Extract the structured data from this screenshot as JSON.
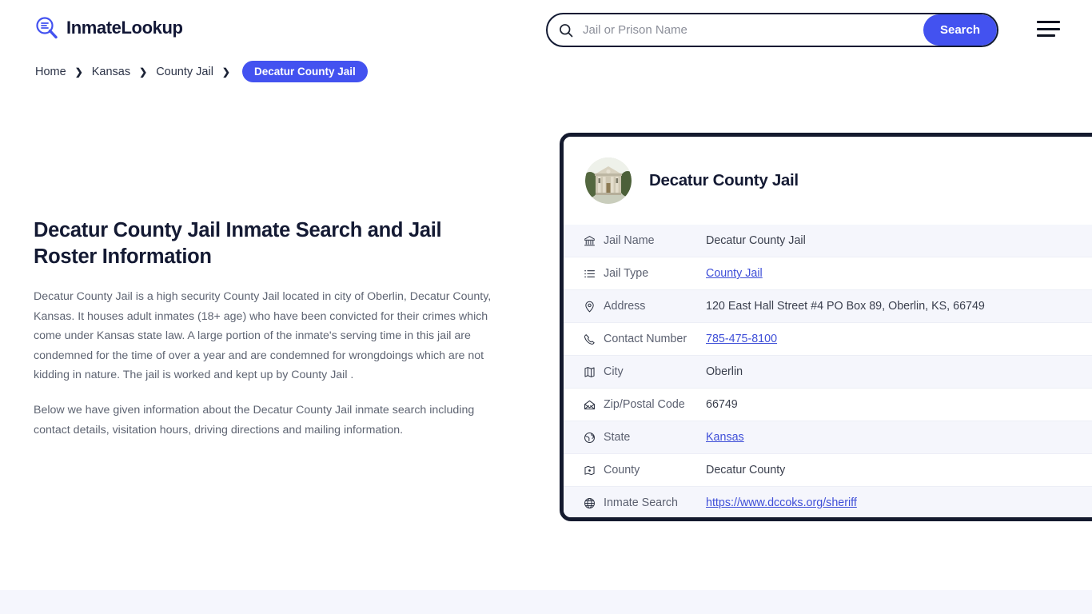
{
  "header": {
    "brand_name": "InmateLookup",
    "brand_icon": "search-list-logo-icon",
    "search": {
      "placeholder": "Jail or Prison Name",
      "value": "",
      "button_label": "Search",
      "icon": "search-icon"
    },
    "menu_icon": "hamburger-menu-icon"
  },
  "breadcrumb": {
    "items": [
      {
        "label": "Home",
        "current": false
      },
      {
        "label": "Kansas",
        "current": false
      },
      {
        "label": "County Jail",
        "current": false
      },
      {
        "label": "Decatur County Jail",
        "current": true
      }
    ],
    "separator": "❯"
  },
  "main": {
    "title": "Decatur County Jail Inmate Search and Jail Roster Information",
    "paragraphs": [
      "Decatur County Jail is a high security County Jail located in city of Oberlin, Decatur County, Kansas. It houses adult inmates (18+ age) who have been convicted for their crimes which come under Kansas state law. A large portion of the inmate's serving time in this jail are condemned for the time of over a year and are condemned for wrongdoings which are not kidding in nature. The jail is worked and kept up by County Jail .",
      "Below we have given information about the Decatur County Jail inmate search including contact details, visitation hours, driving directions and mailing information."
    ]
  },
  "info_card": {
    "photo_alt": "decatur-county-courthouse-photo",
    "title": "Decatur County Jail",
    "rows": [
      {
        "icon": "bank-building-icon",
        "label": "Jail Name",
        "value": "Decatur County Jail",
        "is_link": false
      },
      {
        "icon": "list-icon",
        "label": "Jail Type",
        "value": "County Jail",
        "is_link": true
      },
      {
        "icon": "map-pin-icon",
        "label": "Address",
        "value": "120 East Hall Street #4 PO Box 89, Oberlin, KS, 66749",
        "is_link": false
      },
      {
        "icon": "phone-icon",
        "label": "Contact Number",
        "value": "785-475-8100",
        "is_link": true
      },
      {
        "icon": "map-icon",
        "label": "City",
        "value": "Oberlin",
        "is_link": false
      },
      {
        "icon": "envelope-icon",
        "label": "Zip/Postal Code",
        "value": "66749",
        "is_link": false
      },
      {
        "icon": "globe-icon",
        "label": "State",
        "value": "Kansas",
        "is_link": true
      },
      {
        "icon": "map-marker-area-icon",
        "label": "County",
        "value": "Decatur County",
        "is_link": false
      },
      {
        "icon": "web-globe-icon",
        "label": "Inmate Search",
        "value": "https://www.dccoks.org/sheriff",
        "is_link": true
      }
    ]
  },
  "colors": {
    "accent": "#4352f0",
    "dark": "#141a2e",
    "link": "#3f4fd8",
    "row_alt_bg": "#f5f6fc",
    "band_bg": "#f5f6fd"
  }
}
